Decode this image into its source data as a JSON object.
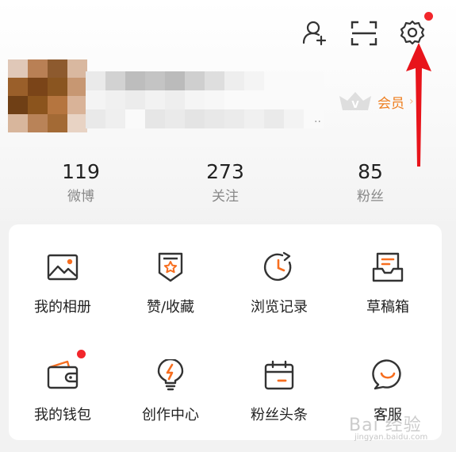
{
  "header": {
    "icons": [
      "add-user-icon",
      "scan-icon",
      "settings-icon"
    ]
  },
  "profile": {
    "vip_label": "会员",
    "vip_badge_letter": "V",
    "vip_arrow": "›",
    "name_ellipsis": ".."
  },
  "stats": [
    {
      "value": "119",
      "label": "微博"
    },
    {
      "value": "273",
      "label": "关注"
    },
    {
      "value": "85",
      "label": "粉丝"
    }
  ],
  "menu": [
    {
      "label": "我的相册",
      "icon": "photo-album-icon"
    },
    {
      "label": "赞/收藏",
      "icon": "favorites-icon"
    },
    {
      "label": "浏览记录",
      "icon": "history-icon"
    },
    {
      "label": "草稿箱",
      "icon": "drafts-icon"
    },
    {
      "label": "我的钱包",
      "icon": "wallet-icon"
    },
    {
      "label": "创作中心",
      "icon": "creator-center-icon"
    },
    {
      "label": "粉丝头条",
      "icon": "fan-headlines-icon"
    },
    {
      "label": "客服",
      "icon": "customer-service-icon"
    }
  ],
  "watermark": {
    "text": "Bai 经验",
    "sub": "jingyan.baidu.com"
  },
  "colors": {
    "accent": "#f76e1f",
    "badge": "#f2262b",
    "annotation": "#e8141b"
  }
}
